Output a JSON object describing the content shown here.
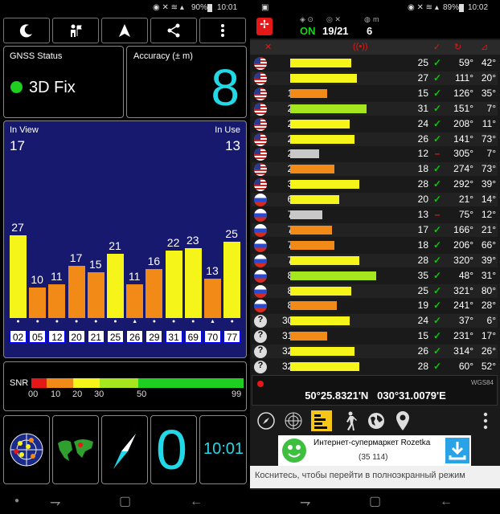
{
  "left": {
    "status_bar": {
      "battery": "90%",
      "time": "10:01"
    },
    "toolbar": {
      "buttons": [
        "moon-icon",
        "person-icon",
        "navigate-icon",
        "share-icon",
        "more-icon"
      ]
    },
    "gnss": {
      "label": "GNSS Status",
      "value": "3D Fix"
    },
    "accuracy": {
      "label": "Accuracy (± m)",
      "value": "8"
    },
    "sky": {
      "in_view_label": "In View",
      "in_view": "17",
      "in_use_label": "In Use",
      "in_use": "13"
    },
    "bars": [
      {
        "prn": "02",
        "snr": 27,
        "color": "#f5f51a",
        "used": true
      },
      {
        "prn": "05",
        "snr": 10,
        "color": "#f28a18",
        "used": true
      },
      {
        "prn": "12",
        "snr": 11,
        "color": "#f28a18",
        "used": true
      },
      {
        "prn": "20",
        "snr": 17,
        "color": "#f28a18",
        "used": true
      },
      {
        "prn": "21",
        "snr": 15,
        "color": "#f28a18",
        "used": true
      },
      {
        "prn": "25",
        "snr": 21,
        "color": "#f5f51a",
        "used": true
      },
      {
        "prn": "26",
        "snr": 11,
        "color": "#f28a18",
        "used": false
      },
      {
        "prn": "29",
        "snr": 16,
        "color": "#f28a18",
        "used": true
      },
      {
        "prn": "31",
        "snr": 22,
        "color": "#f5f51a",
        "used": true
      },
      {
        "prn": "69",
        "snr": 23,
        "color": "#f5f51a",
        "used": true
      },
      {
        "prn": "70",
        "snr": 13,
        "color": "#f28a18",
        "used": false
      },
      {
        "prn": "77",
        "snr": 25,
        "color": "#f5f51a",
        "used": true
      }
    ],
    "snr_legend": {
      "label": "SNR",
      "ticks": [
        "00",
        "10",
        "20",
        "30",
        "50",
        "99"
      ]
    },
    "bottom": {
      "big_value": "0",
      "clock": "10:01"
    }
  },
  "right": {
    "status_bar": {
      "battery": "89%",
      "time": "10:02"
    },
    "header": {
      "on": "ON",
      "sats": "19/21",
      "m_label": "m",
      "m_value": "6"
    },
    "rows": [
      {
        "prn": "2",
        "snr": "25",
        "az": "59°",
        "el": "42°",
        "flag": "us",
        "color": "#f5f51a",
        "w": 76,
        "used": true
      },
      {
        "prn": "5",
        "snr": "27",
        "az": "111°",
        "el": "20°",
        "flag": "us",
        "color": "#f5f51a",
        "w": 83,
        "used": true
      },
      {
        "prn": "12",
        "snr": "15",
        "az": "126°",
        "el": "35°",
        "flag": "us",
        "color": "#f28a18",
        "w": 46,
        "used": true
      },
      {
        "prn": "20",
        "snr": "31",
        "az": "151°",
        "el": "7°",
        "flag": "us",
        "color": "#a6e61e",
        "w": 95,
        "used": true
      },
      {
        "prn": "21",
        "snr": "24",
        "az": "208°",
        "el": "11°",
        "flag": "us",
        "color": "#f5f51a",
        "w": 74,
        "used": true
      },
      {
        "prn": "25",
        "snr": "26",
        "az": "141°",
        "el": "73°",
        "flag": "us",
        "color": "#f5f51a",
        "w": 80,
        "used": true
      },
      {
        "prn": "26",
        "snr": "12",
        "az": "305°",
        "el": "7°",
        "flag": "us",
        "color": "#c8c8c8",
        "w": 36,
        "used": false
      },
      {
        "prn": "29",
        "snr": "18",
        "az": "274°",
        "el": "73°",
        "flag": "us",
        "color": "#f28a18",
        "w": 55,
        "used": true
      },
      {
        "prn": "31",
        "snr": "28",
        "az": "292°",
        "el": "39°",
        "flag": "us",
        "color": "#f5f51a",
        "w": 86,
        "used": true
      },
      {
        "prn": "69",
        "snr": "20",
        "az": "21°",
        "el": "14°",
        "flag": "ru",
        "color": "#f5f51a",
        "w": 61,
        "used": true
      },
      {
        "prn": "70",
        "snr": "13",
        "az": "75°",
        "el": "12°",
        "flag": "ru",
        "color": "#c8c8c8",
        "w": 40,
        "used": false
      },
      {
        "prn": "75",
        "snr": "17",
        "az": "166°",
        "el": "21°",
        "flag": "ru",
        "color": "#f28a18",
        "w": 52,
        "used": true
      },
      {
        "prn": "76",
        "snr": "18",
        "az": "206°",
        "el": "66°",
        "flag": "ru",
        "color": "#f28a18",
        "w": 55,
        "used": true
      },
      {
        "prn": "77",
        "snr": "28",
        "az": "320°",
        "el": "39°",
        "flag": "ru",
        "color": "#f5f51a",
        "w": 86,
        "used": true
      },
      {
        "prn": "85",
        "snr": "35",
        "az": "48°",
        "el": "31°",
        "flag": "ru",
        "color": "#a6e61e",
        "w": 107,
        "used": true
      },
      {
        "prn": "86",
        "snr": "25",
        "az": "321°",
        "el": "80°",
        "flag": "ru",
        "color": "#f5f51a",
        "w": 76,
        "used": true
      },
      {
        "prn": "87",
        "snr": "19",
        "az": "241°",
        "el": "28°",
        "flag": "ru",
        "color": "#f28a18",
        "w": 58,
        "used": true
      },
      {
        "prn": "308",
        "snr": "24",
        "az": "37°",
        "el": "6°",
        "flag": "q",
        "color": "#f5f51a",
        "w": 74,
        "used": true
      },
      {
        "prn": "312",
        "snr": "15",
        "az": "231°",
        "el": "17°",
        "flag": "q",
        "color": "#f28a18",
        "w": 46,
        "used": true
      },
      {
        "prn": "324",
        "snr": "26",
        "az": "314°",
        "el": "26°",
        "flag": "q",
        "color": "#f5f51a",
        "w": 80,
        "used": true
      },
      {
        "prn": "326",
        "snr": "28",
        "az": "60°",
        "el": "52°",
        "flag": "q",
        "color": "#f5f51a",
        "w": 86,
        "used": true
      }
    ],
    "coords": {
      "datum": "WGS84",
      "value": "50°25.8321'N   030°31.0079'E"
    },
    "ad": {
      "title": "Интернет-супермаркет Rozetka",
      "count": "(35 114)",
      "tap": "Коснитесь, чтобы перейти в полноэкранный режим"
    }
  }
}
